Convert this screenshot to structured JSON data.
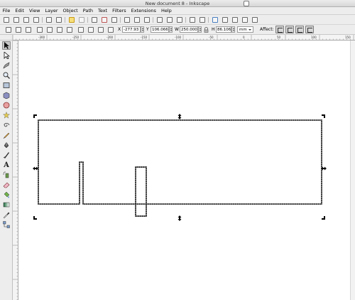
{
  "window": {
    "title": "New document 8 - Inkscape"
  },
  "menubar": {
    "items": [
      "File",
      "Edit",
      "View",
      "Layer",
      "Object",
      "Path",
      "Text",
      "Filters",
      "Extensions",
      "Help"
    ]
  },
  "command_bar": {
    "icons": [
      "new-document-icon",
      "open-icon",
      "save-icon",
      "print-icon",
      "import-icon",
      "export-icon",
      "undo-icon",
      "redo-icon",
      "copy-icon",
      "cut-icon",
      "paste-icon",
      "zoom-selection-icon",
      "zoom-drawing-icon",
      "zoom-page-icon",
      "duplicate-icon",
      "clone-icon",
      "unlink-clone-icon",
      "group-icon",
      "ungroup-icon",
      "fill-stroke-icon",
      "text-font-icon",
      "xml-editor-icon",
      "align-distribute-icon",
      "preferences-icon"
    ]
  },
  "selector_controls": {
    "x": {
      "label": "X",
      "value": "-277.93"
    },
    "y": {
      "label": "Y",
      "value": "106.066"
    },
    "w": {
      "label": "W",
      "value": "250.000"
    },
    "h": {
      "label": "H",
      "value": "86.106"
    },
    "units": "mm",
    "affect_label": "Affect:"
  },
  "ruler": {
    "labels": [
      "-300",
      "-250",
      "-200",
      "-150",
      "-100",
      "-50",
      "0",
      "50",
      "100",
      "150"
    ]
  },
  "toolbox": {
    "tools": [
      "selector-tool-icon",
      "node-tool-icon",
      "tweak-tool-icon",
      "zoom-tool-icon",
      "rect-tool-icon",
      "3dbox-tool-icon",
      "ellipse-tool-icon",
      "star-tool-icon",
      "spiral-tool-icon",
      "pencil-tool-icon",
      "pen-tool-icon",
      "calligraphy-tool-icon",
      "text-tool-icon",
      "spray-tool-icon",
      "eraser-tool-icon",
      "paint-bucket-tool-icon",
      "gradient-tool-icon",
      "dropper-tool-icon",
      "connector-tool-icon"
    ],
    "text_tool_glyph": "A",
    "active": "selector-tool-icon"
  }
}
